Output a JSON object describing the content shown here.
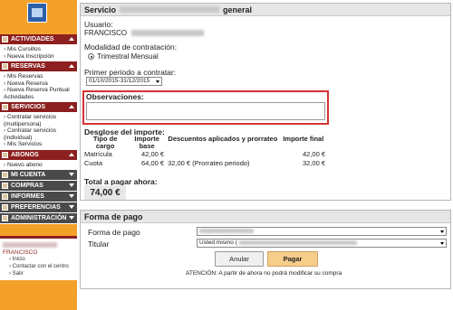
{
  "sidebar": {
    "sections": [
      {
        "title": "ACTIVIDADES",
        "items": [
          "Mis Cursillos",
          "Nueva Inscripción"
        ]
      },
      {
        "title": "RESERVAS",
        "items": [
          "Mis Reservas",
          "Nueva Reserva",
          "Nueva Reserva Puntual Actividades"
        ]
      },
      {
        "title": "SERVICIOS",
        "items": [
          "Contratar servicios (multipersona)",
          "Contratar servicios (individual)",
          "Mis Servicios"
        ]
      },
      {
        "title": "ABONOS",
        "items": [
          "Nuevo abono"
        ]
      },
      {
        "title": "MI CUENTA",
        "items": []
      },
      {
        "title": "COMPRAS",
        "items": []
      },
      {
        "title": "INFORMES",
        "items": []
      },
      {
        "title": "PREFERENCIAS",
        "items": []
      },
      {
        "title": "ADMINISTRACIÓN",
        "items": []
      }
    ],
    "user": {
      "name": "FRANCISCO",
      "links": [
        "Inicio",
        "Contactar con el centro",
        "Salir"
      ]
    }
  },
  "service": {
    "title_prefix": "Servicio",
    "title_suffix": "general",
    "user_label": "Usuario:",
    "user_name": "FRANCISCO",
    "modality_label": "Modalidad de contratación:",
    "modality_option": "Trimestral Mensual",
    "period_label": "Primer periodo a contratar:",
    "period_value": "01/10/2015-31/12/2015",
    "observations_label": "Observaciones:",
    "breakdown_label": "Desglose del importe:",
    "columns": [
      "Tipo de cargo",
      "Importe base",
      "Descuentos aplicados y prorrateo",
      "Importe final"
    ],
    "rows": [
      {
        "type": "Matrícula",
        "base": "42,00 €",
        "discount": "",
        "final": "42,00 €"
      },
      {
        "type": "Cuota",
        "base": "64,00 €",
        "discount": "32,00 € (Prorrateo periodo)",
        "final": "32,00 €"
      }
    ],
    "total_label": "Total a pagar ahora:",
    "total_value": "74,00 €"
  },
  "payment": {
    "title": "Forma de pago",
    "method_label": "Forma de pago",
    "holder_label": "Titular",
    "holder_value": "Usted mismo (",
    "cancel_label": "Anular",
    "pay_label": "Pagar",
    "notice": "ATENCIÓN: A partir de ahora no podrá modificar su compra"
  },
  "colors": {
    "sidebar_bg": "#f4a12a",
    "section_head": "#8c1f1f",
    "highlight": "#d63333",
    "pay_button": "#f7cd8a"
  }
}
